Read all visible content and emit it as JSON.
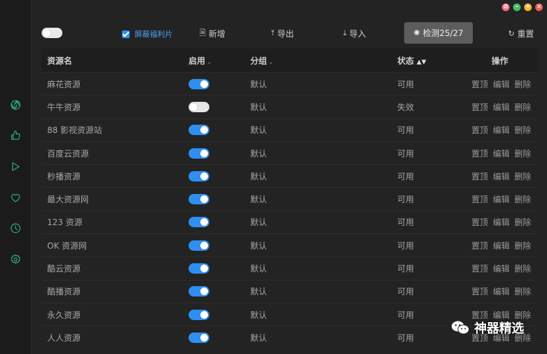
{
  "window": {
    "controls": [
      {
        "name": "pin",
        "color": "#f2707f",
        "glyph": "⊘"
      },
      {
        "name": "minimize",
        "color": "#3cc06c",
        "glyph": "–"
      },
      {
        "name": "maximize",
        "color": "#f2b233",
        "glyph": "+"
      },
      {
        "name": "close",
        "color": "#f25656",
        "glyph": "×"
      }
    ]
  },
  "sidebar": {
    "items": [
      {
        "icon": "aperture-icon"
      },
      {
        "icon": "thumbs-up-icon"
      },
      {
        "icon": "play-icon"
      },
      {
        "icon": "heart-icon"
      },
      {
        "icon": "clock-icon"
      },
      {
        "icon": "settings-icon"
      }
    ],
    "accent": "#2fb37a"
  },
  "toolbar": {
    "filter_label": "屏蔽福利片",
    "add_label": "新增",
    "export_label": "导出",
    "import_label": "导入",
    "check_label": "检测25/27",
    "reset_label": "重置"
  },
  "table": {
    "headers": {
      "name": "资源名",
      "enable": "启用",
      "group": "分组",
      "status": "状态",
      "ops": "操作"
    },
    "op_labels": {
      "top": "置顶",
      "edit": "编辑",
      "delete": "删除"
    },
    "rows": [
      {
        "name": "麻花资源",
        "enabled": true,
        "group": "默认",
        "status": "可用"
      },
      {
        "name": "牛牛资源",
        "enabled": false,
        "group": "默认",
        "status": "失效"
      },
      {
        "name": "88 影视资源站",
        "enabled": true,
        "group": "默认",
        "status": "可用"
      },
      {
        "name": "百度云资源",
        "enabled": true,
        "group": "默认",
        "status": "可用"
      },
      {
        "name": "秒播资源",
        "enabled": true,
        "group": "默认",
        "status": "可用"
      },
      {
        "name": "最大资源网",
        "enabled": true,
        "group": "默认",
        "status": "可用"
      },
      {
        "name": "123 资源",
        "enabled": true,
        "group": "默认",
        "status": "可用"
      },
      {
        "name": "OK 资源网",
        "enabled": true,
        "group": "默认",
        "status": "可用"
      },
      {
        "name": "酷云资源",
        "enabled": true,
        "group": "默认",
        "status": "可用"
      },
      {
        "name": "酷播资源",
        "enabled": true,
        "group": "默认",
        "status": "可用"
      },
      {
        "name": "永久资源",
        "enabled": true,
        "group": "默认",
        "status": "可用"
      },
      {
        "name": "人人资源",
        "enabled": true,
        "group": "默认",
        "status": "可用"
      }
    ]
  },
  "watermark": {
    "text": "神器精选"
  }
}
